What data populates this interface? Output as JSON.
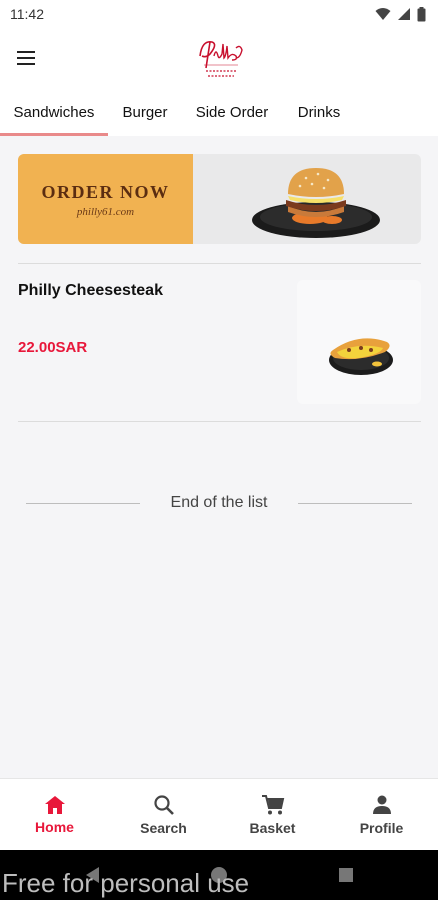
{
  "status_bar": {
    "time": "11:42"
  },
  "logo": {
    "text": "Philly61",
    "tagline": "let's meet & eat"
  },
  "tabs": [
    {
      "label": "Sandwiches",
      "active": true
    },
    {
      "label": "Burger",
      "active": false
    },
    {
      "label": "Side Order",
      "active": false
    },
    {
      "label": "Drinks",
      "active": false
    }
  ],
  "banner": {
    "title": "ORDER NOW",
    "subtitle": "philly61.com"
  },
  "products": [
    {
      "name": "Philly Cheesesteak",
      "price": "22.00SAR"
    }
  ],
  "end_of_list": "End of the list",
  "bottom_nav": [
    {
      "label": "Home",
      "icon": "home-icon",
      "active": true
    },
    {
      "label": "Search",
      "icon": "search-icon",
      "active": false
    },
    {
      "label": "Basket",
      "icon": "cart-icon",
      "active": false
    },
    {
      "label": "Profile",
      "icon": "person-icon",
      "active": false
    }
  ],
  "watermark": "Free for personal use",
  "colors": {
    "accent": "#e8173a",
    "tab_indicator": "#e98a8a",
    "banner_orange": "#f1b251"
  }
}
